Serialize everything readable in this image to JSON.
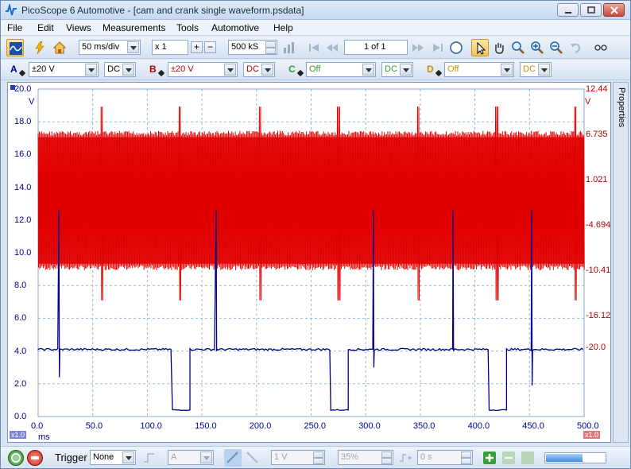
{
  "window": {
    "title": "PicoScope 6 Automotive - [cam and crank single waveform.psdata]"
  },
  "menu": [
    "File",
    "Edit",
    "Views",
    "Measurements",
    "Tools",
    "Automotive",
    "Help"
  ],
  "toolbar": {
    "timebase": "50 ms/div",
    "zoom": "x 1",
    "samples": "500 kS",
    "buffer": "1 of 1"
  },
  "channels": {
    "a": {
      "label": "A",
      "range": "±20 V",
      "coupling": "DC",
      "color": "#00008b"
    },
    "b": {
      "label": "B",
      "range": "±20 V",
      "coupling": "DC",
      "color": "#b00000"
    },
    "c": {
      "label": "C",
      "range": "Off",
      "coupling": "DC",
      "color": "#3a9a3a"
    },
    "d": {
      "label": "D",
      "range": "Off",
      "coupling": "DC",
      "color": "#c69200"
    }
  },
  "axes": {
    "left_ticks": [
      "20.0",
      "18.0",
      "16.0",
      "14.0",
      "12.0",
      "10.0",
      "8.0",
      "6.0",
      "4.0",
      "2.0",
      "0.0"
    ],
    "left_unit": "V",
    "right_ticks": [
      "12.44",
      "6.735",
      "1.021",
      "-4.694",
      "-10.41",
      "-16.12",
      "-20.0"
    ],
    "right_unit": "V",
    "x_ticks": [
      "0.0",
      "50.0",
      "100.0",
      "150.0",
      "200.0",
      "250.0",
      "300.0",
      "350.0",
      "400.0",
      "450.0",
      "500.0"
    ],
    "x_unit": "ms",
    "corner_left": "x1.0",
    "corner_right": "x1.0"
  },
  "chart_data": {
    "type": "line",
    "x_unit": "ms",
    "xlim": [
      0,
      500
    ],
    "grid": true,
    "series": [
      {
        "channel": "A",
        "color": "#00008b",
        "ylim": [
          0,
          20
        ],
        "baseline": 4.1,
        "spikes": [
          {
            "x": 19,
            "top": 12.6,
            "bottom": 2.4
          },
          {
            "x": 163,
            "top": 12.6,
            "bottom": 4.0
          },
          {
            "x": 307,
            "top": 12.6,
            "bottom": 3.0
          },
          {
            "x": 380,
            "top": 12.6,
            "bottom": 4.0
          },
          {
            "x": 452,
            "top": 12.6,
            "bottom": 1.9
          }
        ],
        "dips": [
          {
            "x_start": 123,
            "x_end": 139,
            "level": 0.4
          },
          {
            "x_start": 268,
            "x_end": 284,
            "level": 0.4
          },
          {
            "x_start": 413,
            "x_end": 429,
            "level": 0.4
          }
        ]
      },
      {
        "channel": "B",
        "color": "#e00000",
        "ylim": [
          -20,
          12.44
        ],
        "low": -5.5,
        "high": 8.3,
        "start": 0,
        "end": 500,
        "gaps": [
          58,
          130,
          203,
          275,
          348,
          420,
          492
        ]
      }
    ]
  },
  "settings": {
    "properties_label": "Properties",
    "trigger_label": "Trigger",
    "trigger_mode": "None",
    "trigger_source": "A",
    "trigger_level": "1 V",
    "pretrigger": "35%",
    "delay": "0 s",
    "progress_percent": 60
  }
}
